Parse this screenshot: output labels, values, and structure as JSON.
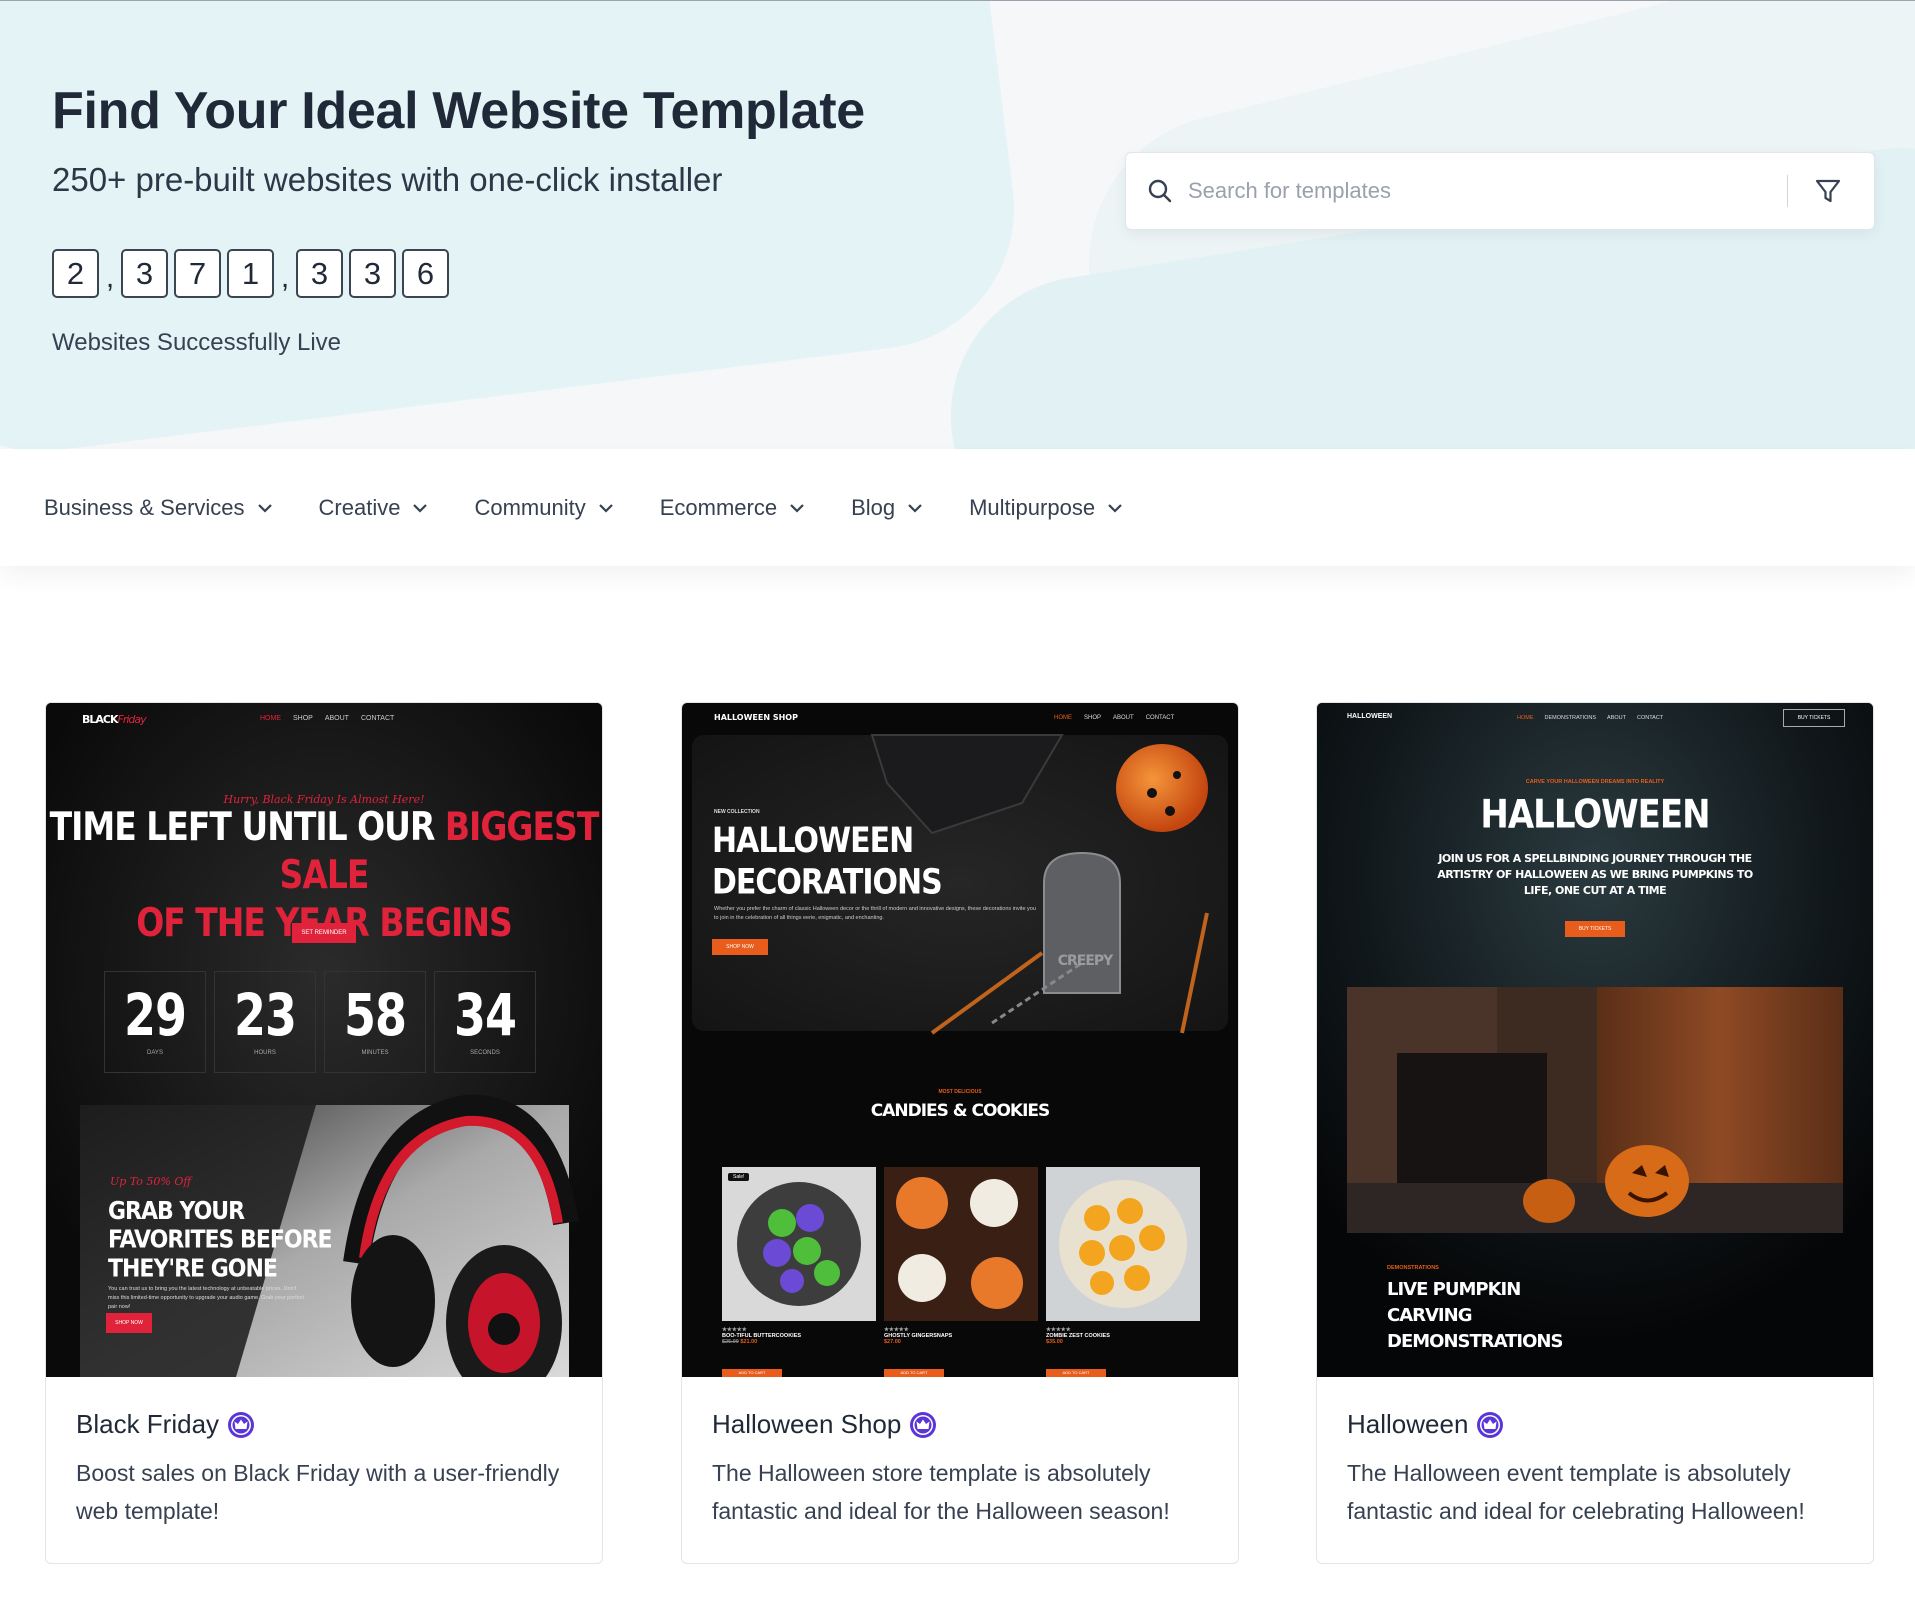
{
  "hero": {
    "title": "Find Your Ideal Website Template",
    "subtitle": "250+ pre-built websites with one-click installer",
    "counter_digits": [
      "2",
      "3",
      "7",
      "1",
      "3",
      "3",
      "6"
    ],
    "counter_separator": ",",
    "counter_label": "Websites Successfully Live"
  },
  "search": {
    "placeholder": "Search for templates",
    "search_icon": "search-icon",
    "filter_icon": "filter-icon"
  },
  "categories": [
    {
      "label": "Business & Services",
      "icon": "chevron-down-icon"
    },
    {
      "label": "Creative",
      "icon": "chevron-down-icon"
    },
    {
      "label": "Community",
      "icon": "chevron-down-icon"
    },
    {
      "label": "Ecommerce",
      "icon": "chevron-down-icon"
    },
    {
      "label": "Blog",
      "icon": "chevron-down-icon"
    },
    {
      "label": "Multipurpose",
      "icon": "chevron-down-icon"
    }
  ],
  "colors": {
    "premium_badge": "#5b36d6",
    "accent_red": "#e0233b",
    "accent_orange": "#e85d1c"
  },
  "templates": [
    {
      "name": "Black Friday",
      "badge_icon": "crown-icon",
      "description": "Boost sales on Black Friday with a user-friendly web template!",
      "preview": {
        "logo_a": "BLACK",
        "logo_b": "Friday",
        "nav": [
          "HOME",
          "SHOP",
          "ABOUT",
          "CONTACT"
        ],
        "script_line": "Hurry, Black Friday Is Almost Here!",
        "headline_white": "TIME LEFT UNTIL OUR",
        "headline_red": "BIGGEST SALE",
        "headline_red2": "OF THE YEAR BEGINS",
        "button": "SET REMINDER",
        "countdown": [
          {
            "value": "29",
            "unit": "DAYS"
          },
          {
            "value": "23",
            "unit": "HOURS"
          },
          {
            "value": "58",
            "unit": "MINUTES"
          },
          {
            "value": "34",
            "unit": "SECONDS"
          }
        ],
        "promo_script": "Up To 50% Off",
        "promo_line1": "GRAB YOUR",
        "promo_line2": "FAVORITES BEFORE",
        "promo_line3": "THEY'RE GONE",
        "promo_text": "You can trust us to bring you the latest technology at unbeatable prices. Don't miss this limited-time opportunity to upgrade your audio game. Grab your perfect pair now!",
        "promo_button": "SHOP NOW"
      }
    },
    {
      "name": "Halloween Shop",
      "badge_icon": "crown-icon",
      "description": "The Halloween store template is absolutely fantastic and ideal for the Halloween season!",
      "preview": {
        "logo": "HALLOWEEN SHOP",
        "nav": [
          "HOME",
          "SHOP",
          "ABOUT",
          "CONTACT"
        ],
        "kicker": "NEW COLLECTION",
        "headline1": "HALLOWEEN",
        "headline2": "DECORATIONS",
        "body": "Whether you prefer the charm of classic Halloween decor or the thrill of modern and innovative designs, these decorations invite you to join in the celebration of all things eerie, enigmatic, and enchanting.",
        "button": "SHOP NOW",
        "tomb_text": "CREEPY",
        "section_kicker": "MOST DELICIOUS",
        "section_title": "CANDIES & COOKIES",
        "products": [
          {
            "name": "BOO-TIFUL BUTTERCOOKIES",
            "old_price": "$25.00",
            "price": "$21.00",
            "badge": "Sale!",
            "button": "ADD TO CART"
          },
          {
            "name": "GHOSTLY GINGERSNAPS",
            "old_price": "",
            "price": "$27.00",
            "badge": "",
            "button": "ADD TO CART"
          },
          {
            "name": "ZOMBIE ZEST COOKIES",
            "old_price": "",
            "price": "$35.00",
            "badge": "",
            "button": "ADD TO CART"
          }
        ]
      }
    },
    {
      "name": "Halloween",
      "badge_icon": "crown-icon",
      "description": "The Halloween event template is absolutely fantastic and ideal for celebrating Halloween!",
      "preview": {
        "logo": "HALLOWEEN",
        "nav": [
          "HOME",
          "DEMONSTRATIONS",
          "ABOUT",
          "CONTACT"
        ],
        "nav_button": "BUY TICKETS",
        "kicker": "CARVE YOUR HALLOWEEN DREAMS INTO REALITY",
        "headline": "HALLOWEEN",
        "tagline": "JOIN US FOR A SPELLBINDING JOURNEY THROUGH THE ARTISTRY OF HALLOWEEN AS WE BRING PUMPKINS TO LIFE, ONE CUT AT A TIME",
        "button": "BUY TICKETS",
        "section_kicker": "DEMONSTRATIONS",
        "section_title1": "LIVE PUMPKIN",
        "section_title2": "CARVING",
        "section_title3": "DEMONSTRATIONS"
      }
    }
  ]
}
